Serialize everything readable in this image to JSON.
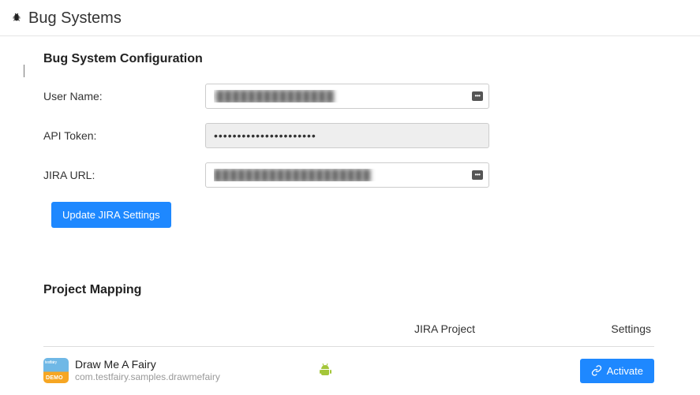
{
  "header": {
    "title": "Bug Systems"
  },
  "config": {
    "section_title": "Bug System Configuration",
    "labels": {
      "username": "User Name:",
      "api_token": "API Token:",
      "jira_url": "JIRA URL:"
    },
    "values": {
      "username": "l███████████████",
      "api_token": "••••••••••••••••••••••",
      "jira_url": "████████████████████"
    },
    "update_btn": "Update JIRA Settings"
  },
  "mapping": {
    "section_title": "Project Mapping",
    "columns": {
      "jira": "JIRA Project",
      "settings": "Settings"
    },
    "rows": [
      {
        "app_name": "Draw Me A Fairy",
        "app_id": "com.testfairy.samples.drawmefairy",
        "platform": "android",
        "action_label": "Activate"
      }
    ]
  }
}
